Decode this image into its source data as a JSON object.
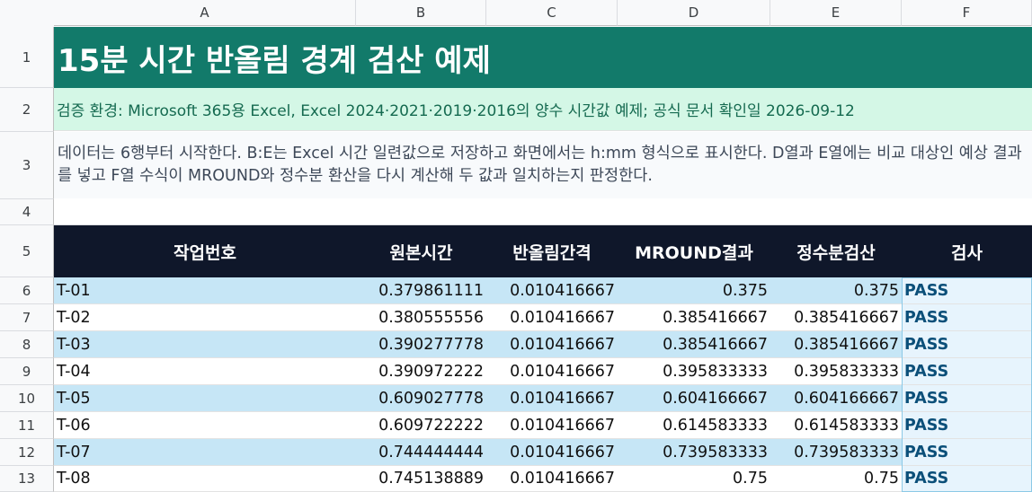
{
  "columns": [
    "A",
    "B",
    "C",
    "D",
    "E",
    "F"
  ],
  "rows": [
    "1",
    "2",
    "3",
    "4",
    "5",
    "6",
    "7",
    "8",
    "9",
    "10",
    "11",
    "12",
    "13"
  ],
  "title": "15분 시간 반올림 경계 검산 예제",
  "environment": "검증 환경: Microsoft 365용 Excel, Excel 2024·2021·2019·2016의 양수 시간값 예제; 공식 문서 확인일 2026-09-12",
  "description": "데이터는 6행부터 시작한다. B:E는 Excel 시간 일련값으로 저장하고 화면에서는 h:mm 형식으로 표시한다. D열과 E열에는 비교 대상인 예상 결과를 넣고 F열 수식이 MROUND와 정수분 환산을 다시 계산해 두 값과 일치하는지 판정한다.",
  "headers": [
    "작업번호",
    "원본시간",
    "반올림간격",
    "MROUND결과",
    "정수분검산",
    "검사"
  ],
  "table": [
    [
      "T-01",
      "0.379861111",
      "0.010416667",
      "0.375",
      "0.375",
      "PASS"
    ],
    [
      "T-02",
      "0.380555556",
      "0.010416667",
      "0.385416667",
      "0.385416667",
      "PASS"
    ],
    [
      "T-03",
      "0.390277778",
      "0.010416667",
      "0.385416667",
      "0.385416667",
      "PASS"
    ],
    [
      "T-04",
      "0.390972222",
      "0.010416667",
      "0.395833333",
      "0.395833333",
      "PASS"
    ],
    [
      "T-05",
      "0.609027778",
      "0.010416667",
      "0.604166667",
      "0.604166667",
      "PASS"
    ],
    [
      "T-06",
      "0.609722222",
      "0.010416667",
      "0.614583333",
      "0.614583333",
      "PASS"
    ],
    [
      "T-07",
      "0.744444444",
      "0.010416667",
      "0.739583333",
      "0.739583333",
      "PASS"
    ],
    [
      "T-08",
      "0.745138889",
      "0.010416667",
      "0.75",
      "0.75",
      "PASS"
    ]
  ],
  "colors": {
    "title_bg": "#127a6a",
    "env_bg": "#d4f7e6",
    "header_bg": "#0f172a",
    "band": "#c6e6f6",
    "pass_text": "#0b4f79"
  }
}
